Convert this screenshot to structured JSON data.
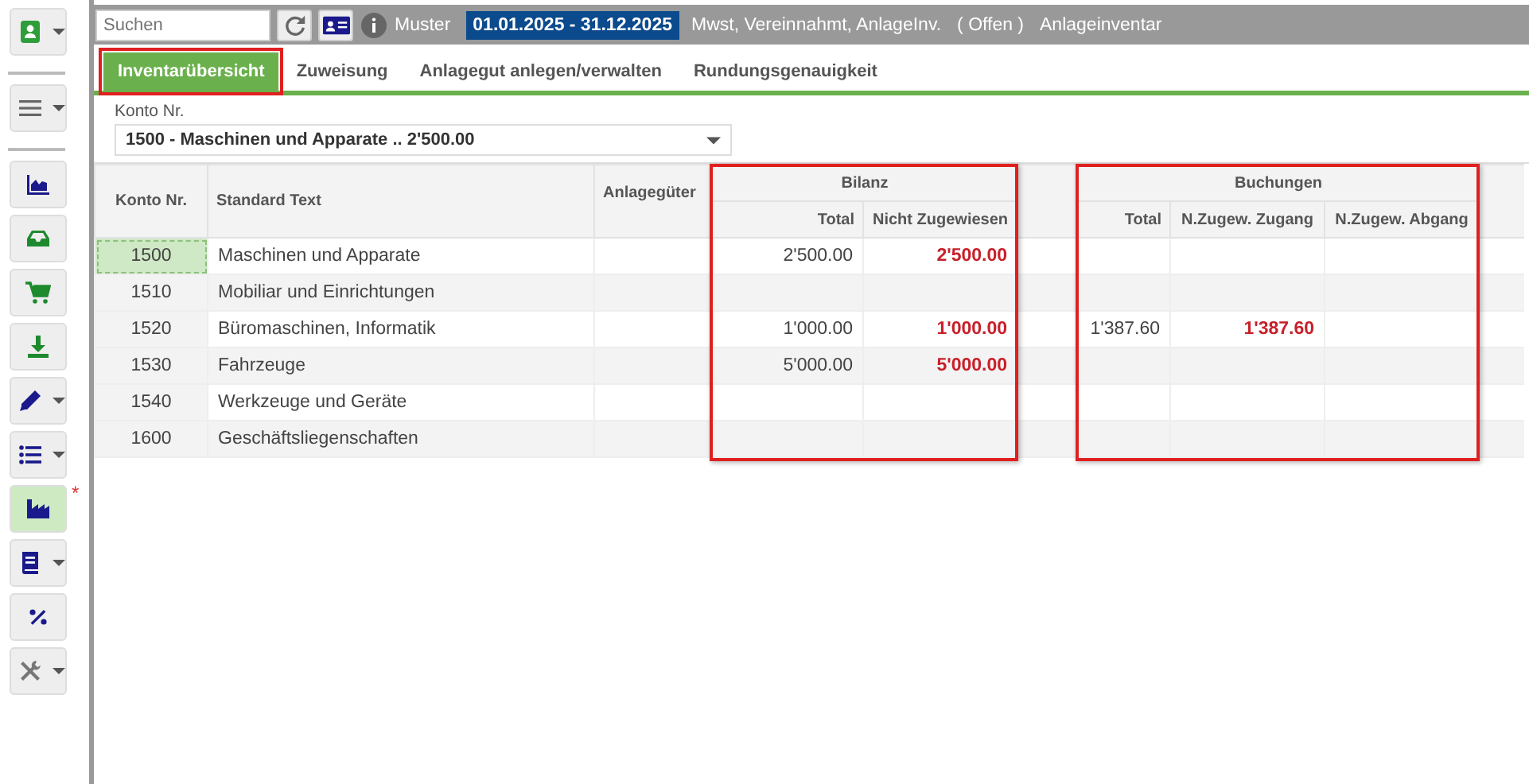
{
  "sidebar": {
    "groups": [
      [
        {
          "kind": "contact",
          "dropdown": true,
          "selected": false
        }
      ],
      [
        {
          "kind": "menu",
          "dropdown": true,
          "selected": false
        }
      ],
      [
        {
          "kind": "chart",
          "dropdown": false,
          "selected": false
        },
        {
          "kind": "inbox",
          "dropdown": false,
          "selected": false
        },
        {
          "kind": "cart",
          "dropdown": false,
          "selected": false
        },
        {
          "kind": "download",
          "dropdown": false,
          "selected": false
        },
        {
          "kind": "pencil",
          "dropdown": true,
          "selected": false
        },
        {
          "kind": "list",
          "dropdown": true,
          "selected": false
        },
        {
          "kind": "factory",
          "dropdown": false,
          "selected": true,
          "badge": "*"
        },
        {
          "kind": "book",
          "dropdown": true,
          "selected": false
        },
        {
          "kind": "percent",
          "dropdown": false,
          "selected": false
        },
        {
          "kind": "tools",
          "dropdown": true,
          "selected": false
        }
      ]
    ]
  },
  "top_bar": {
    "search": {
      "placeholder": "Suchen"
    },
    "company": "Muster",
    "period": "01.01.2025 - 31.12.2025",
    "settings": "Mwst, Vereinnahmt, AnlageInv.",
    "status": "( Offen )",
    "module": "Anlageinventar"
  },
  "tabs": [
    {
      "label": "Inventarübersicht",
      "selected": true,
      "highlighted": true
    },
    {
      "label": "Zuweisung",
      "selected": false,
      "highlighted": false
    },
    {
      "label": "Anlagegut anlegen/verwalten",
      "selected": false,
      "highlighted": false
    },
    {
      "label": "Rundungsgenauigkeit",
      "selected": false,
      "highlighted": false
    }
  ],
  "account_field": {
    "label": "Konto Nr.",
    "value": "1500 - Maschinen und Apparate .. 2'500.00"
  },
  "table": {
    "columns": [
      "Konto Nr.",
      "Standard Text",
      "Anlagegüter"
    ],
    "groups": [
      {
        "label": "Bilanz",
        "highlighted": true,
        "columns": [
          {
            "label": "Total",
            "kind": "total"
          },
          {
            "label": "Nicht Zugewiesen",
            "kind": "unassigned"
          }
        ]
      },
      {
        "label": "Buchungen",
        "highlighted": true,
        "columns": [
          {
            "label": "Total",
            "kind": "total"
          },
          {
            "label": "N.Zugew. Zugang",
            "kind": "unassigned"
          },
          {
            "label": "N.Zugew. Abgang",
            "kind": "unassigned"
          }
        ]
      }
    ],
    "rows": [
      {
        "konto": "1500",
        "text": "Maschinen und Apparate",
        "selected": true,
        "values": {
          "bilanz_total": "2'500.00",
          "bilanz_unassigned": "2'500.00"
        }
      },
      {
        "konto": "1510",
        "text": "Mobiliar und Einrichtungen",
        "selected": false,
        "values": {}
      },
      {
        "konto": "1520",
        "text": "Büromaschinen, Informatik",
        "selected": false,
        "values": {
          "bilanz_total": "1'000.00",
          "bilanz_unassigned": "1'000.00",
          "buchungen_total": "1'387.60",
          "buchungen_zugang": "1'387.60"
        }
      },
      {
        "konto": "1530",
        "text": "Fahrzeuge",
        "selected": false,
        "values": {
          "bilanz_total": "5'000.00",
          "bilanz_unassigned": "5'000.00"
        }
      },
      {
        "konto": "1540",
        "text": "Werkzeuge und Geräte",
        "selected": false,
        "values": {}
      },
      {
        "konto": "1600",
        "text": "Geschäftsliegenschaften",
        "selected": false,
        "values": {}
      }
    ]
  }
}
